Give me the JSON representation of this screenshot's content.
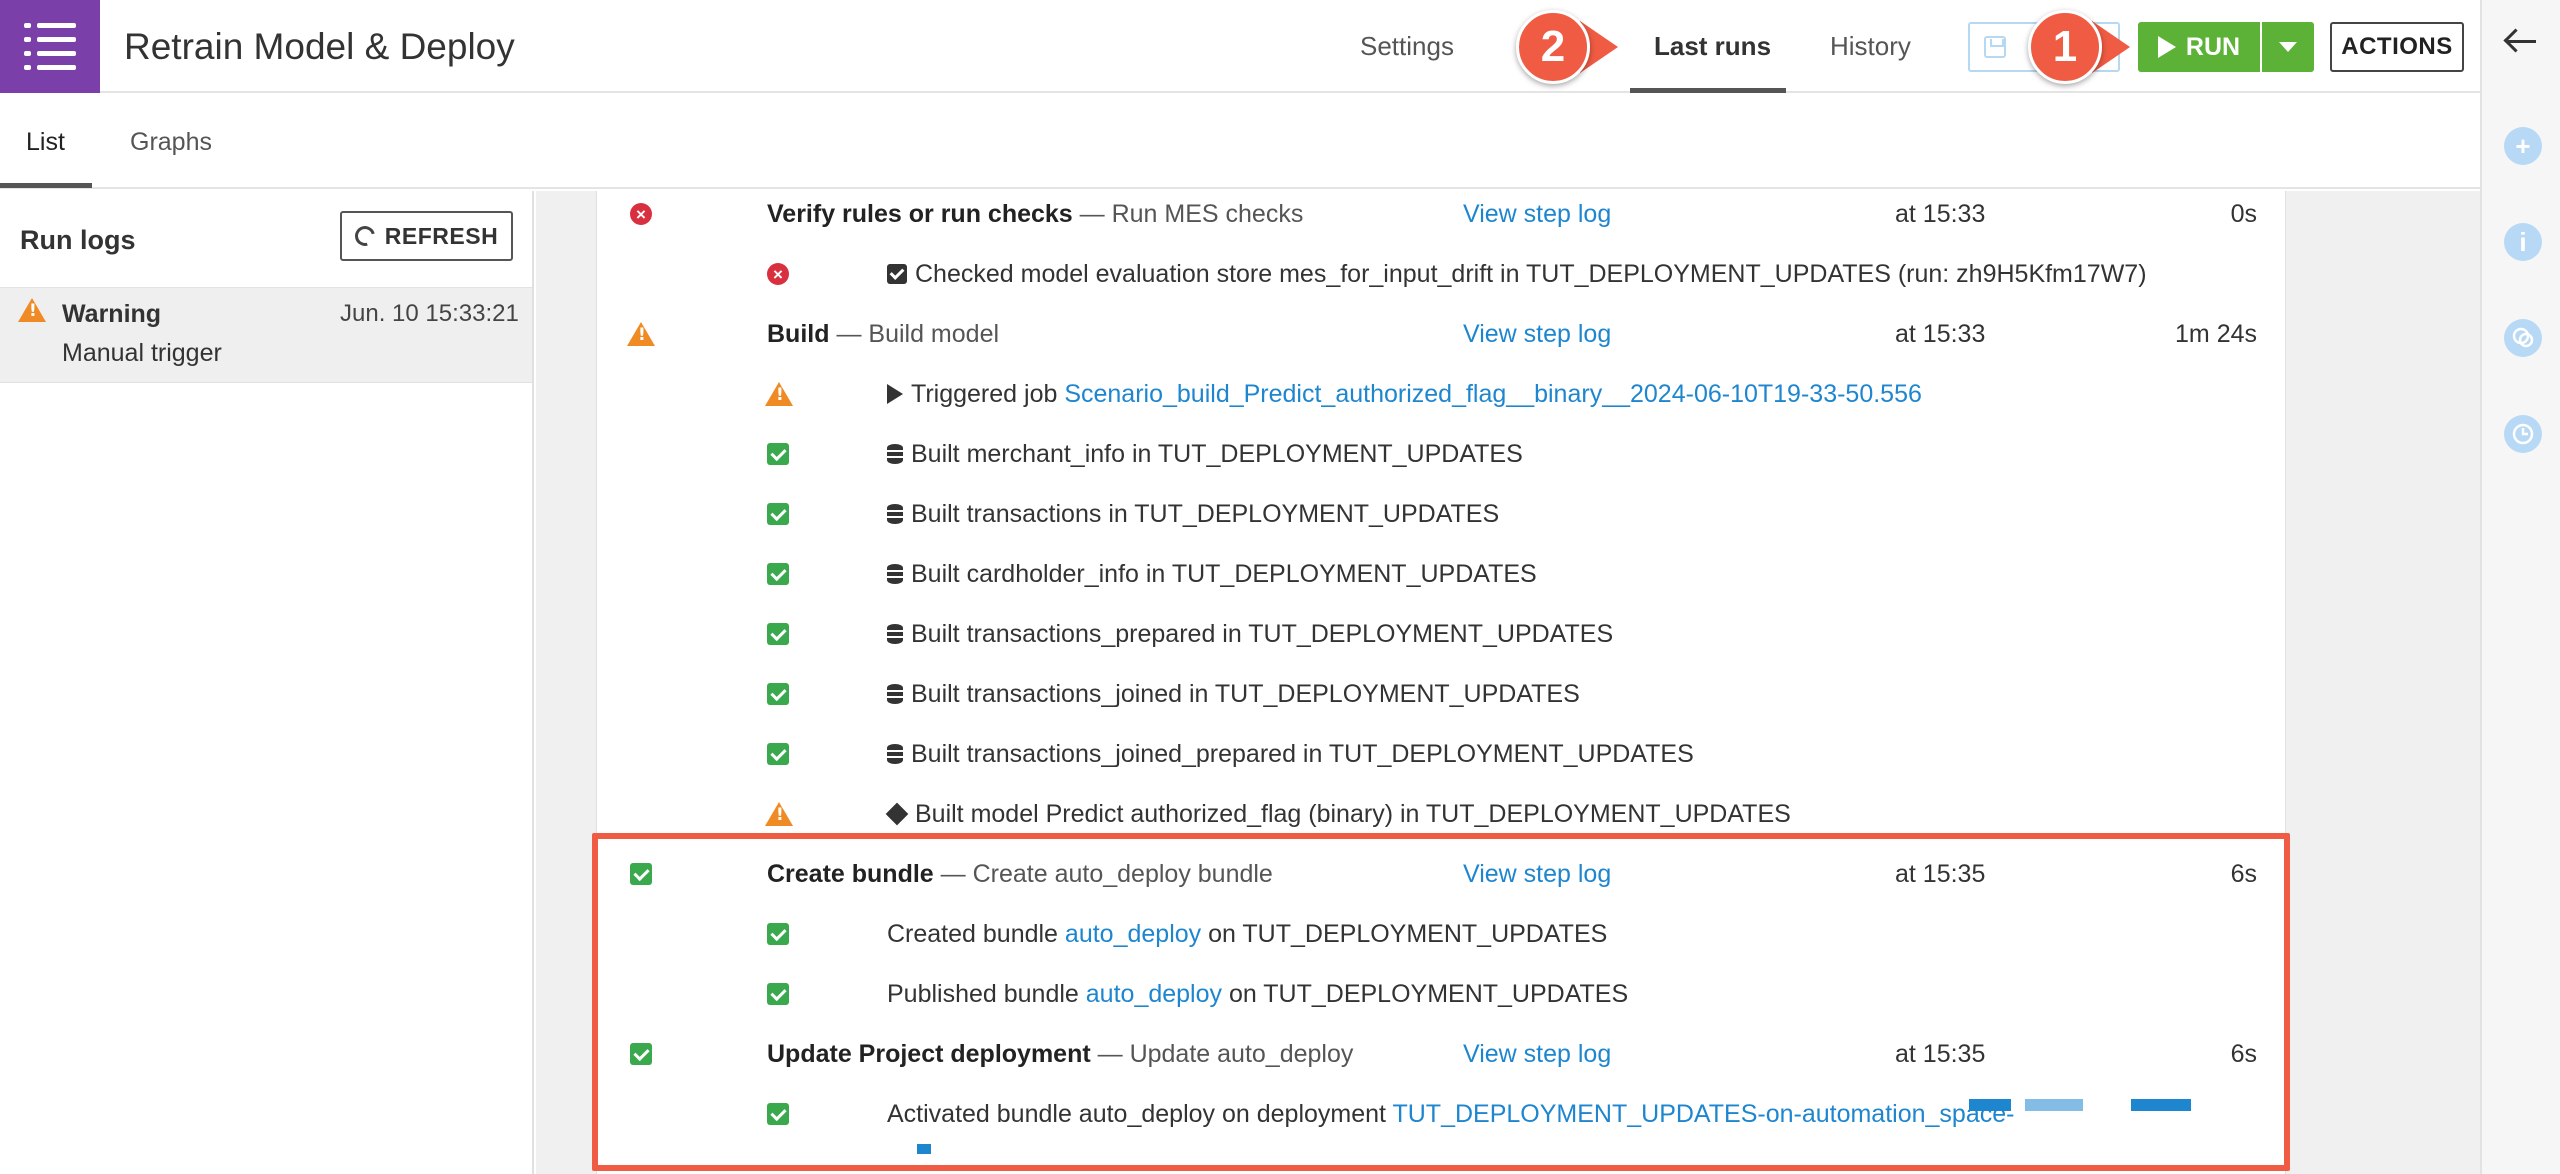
{
  "app": {
    "title": "Retrain Model & Deploy"
  },
  "top_tabs": {
    "settings": "Settings",
    "last_runs": "Last runs",
    "history": "History"
  },
  "toolbar": {
    "run_label": "RUN",
    "actions_label": "ACTIONS"
  },
  "callouts": {
    "one": "1",
    "two": "2"
  },
  "sub_tabs": {
    "list": "List",
    "graphs": "Graphs"
  },
  "run_logs": {
    "title": "Run logs",
    "refresh_label": "REFRESH",
    "selected_run": {
      "status": "Warning",
      "date": "Jun. 10 15:33:21",
      "trigger": "Manual trigger"
    }
  },
  "steps": {
    "verify": {
      "name": "Verify rules or run checks",
      "desc": "— Run MES checks",
      "view_log": "View step log",
      "at": "at 15:33",
      "duration": "0s",
      "details": [
        {
          "text": "Checked model evaluation store mes_for_input_drift in TUT_DEPLOYMENT_UPDATES (run: zh9H5Kfm17W7)"
        }
      ]
    },
    "build": {
      "name": "Build",
      "desc": "— Build model",
      "view_log": "View step log",
      "at": "at 15:33",
      "duration": "1m 24s",
      "job_prefix": "Triggered job",
      "job_link": "Scenario_build_Predict_authorized_flag__binary__2024-06-10T19-33-50.556",
      "details": [
        {
          "text": "Built merchant_info in TUT_DEPLOYMENT_UPDATES"
        },
        {
          "text": "Built transactions in TUT_DEPLOYMENT_UPDATES"
        },
        {
          "text": "Built cardholder_info in TUT_DEPLOYMENT_UPDATES"
        },
        {
          "text": "Built transactions_prepared in TUT_DEPLOYMENT_UPDATES"
        },
        {
          "text": "Built transactions_joined in TUT_DEPLOYMENT_UPDATES"
        },
        {
          "text": "Built transactions_joined_prepared in TUT_DEPLOYMENT_UPDATES"
        },
        {
          "text": "Built model Predict authorized_flag (binary) in TUT_DEPLOYMENT_UPDATES"
        }
      ]
    },
    "bundle": {
      "name": "Create bundle",
      "desc": "— Create auto_deploy bundle",
      "view_log": "View step log",
      "at": "at 15:35",
      "duration": "6s",
      "created_prefix": "Created bundle",
      "created_link": "auto_deploy",
      "created_suffix": "on TUT_DEPLOYMENT_UPDATES",
      "published_prefix": "Published bundle",
      "published_link": "auto_deploy",
      "published_suffix": "on TUT_DEPLOYMENT_UPDATES"
    },
    "deploy": {
      "name": "Update Project deployment",
      "desc": "— Update auto_deploy",
      "view_log": "View step log",
      "at": "at 15:35",
      "duration": "6s",
      "activated_prefix": "Activated bundle auto_deploy on deployment",
      "activated_link": "TUT_DEPLOYMENT_UPDATES-on-automation_space-"
    }
  },
  "colors": {
    "brand_purple": "#7b3fa9",
    "run_green": "#5bb236",
    "link_blue": "#1e86cf",
    "success": "#3aa84d",
    "warning": "#f08a24",
    "error": "#d9303f",
    "callout": "#ef5b43"
  }
}
